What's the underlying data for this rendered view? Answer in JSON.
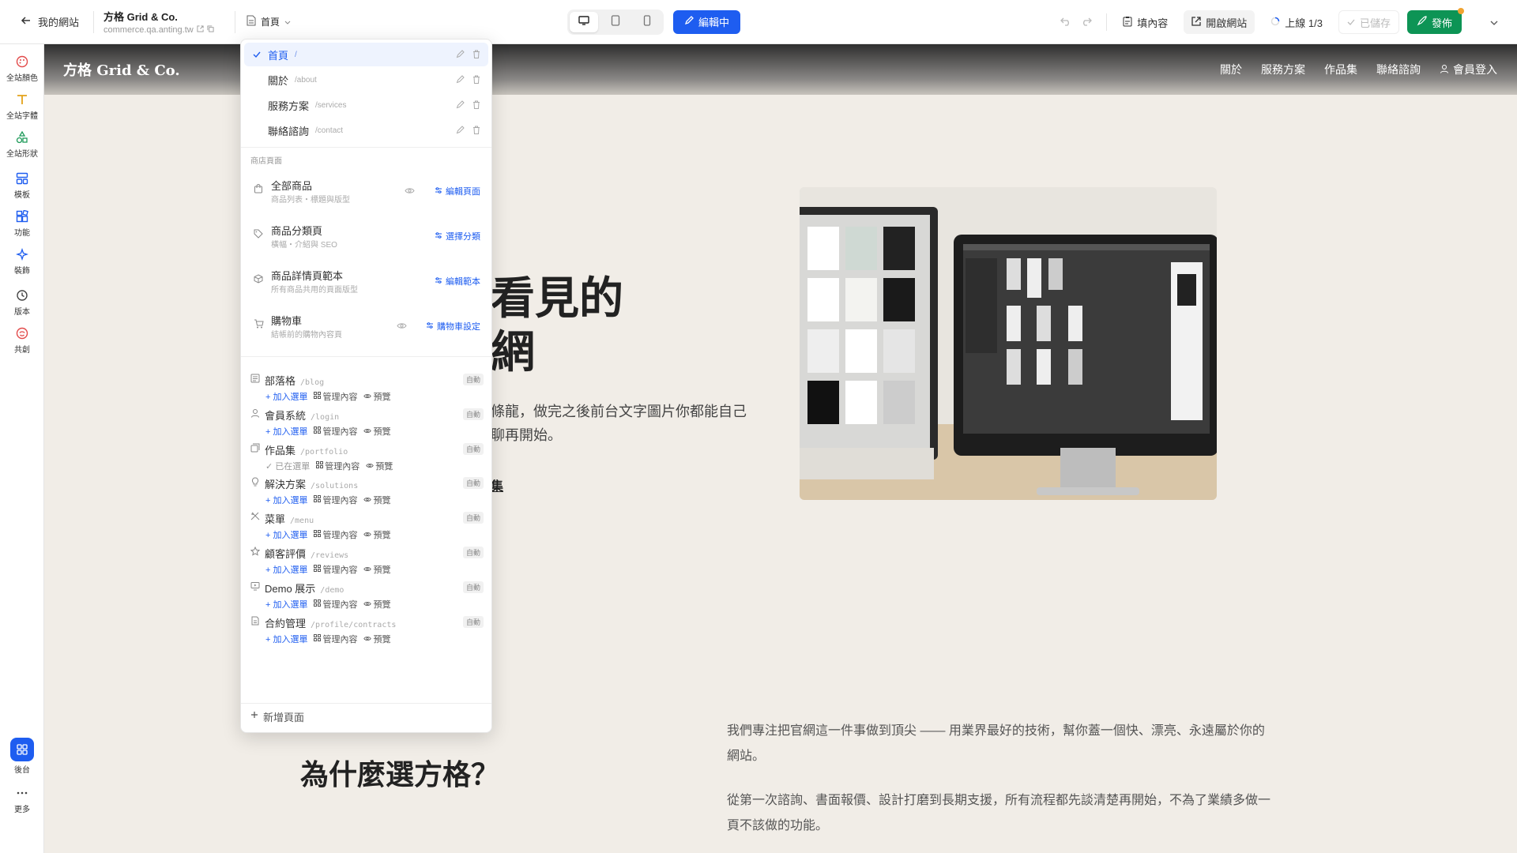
{
  "topbar": {
    "back_label": "我的網站",
    "site_name": "方格 Grid & Co.",
    "site_url": "commerce.qa.anting.tw",
    "current_page": "首頁",
    "edit_label": "編輯中",
    "fill_content": "填內容",
    "open_site": "開啟網站",
    "online": "上線 1/3",
    "saved": "已儲存",
    "publish": "發佈"
  },
  "sidebar": {
    "items": [
      {
        "label": "全站顏色",
        "icon": "palette-icon"
      },
      {
        "label": "全站字體",
        "icon": "text-icon"
      },
      {
        "label": "全站形狀",
        "icon": "shapes-icon"
      },
      {
        "label": "模板",
        "icon": "template-icon"
      },
      {
        "label": "功能",
        "icon": "blocks-icon"
      },
      {
        "label": "裝飾",
        "icon": "sparkle-icon"
      },
      {
        "label": "版本",
        "icon": "history-icon"
      },
      {
        "label": "共創",
        "icon": "cocreate-icon"
      }
    ],
    "admin_label": "後台",
    "more_label": "更多"
  },
  "site": {
    "logo": "方格 Grid & Co.",
    "nav": [
      "關於",
      "服務方案",
      "作品集",
      "聯絡諮詢"
    ],
    "login": "會員登入",
    "hero_line1": "看見的",
    "hero_line2": "網",
    "hero_desc": "條龍，做完之後前台文字圖片你都能自己\n聊再開始。",
    "hero_link": "集",
    "why_title": "為什麼選方格？",
    "why_p1": "我們專注把官網這一件事做到頂尖 —— 用業界最好的技術，幫你蓋一個快、漂亮、永遠屬於你的網站。",
    "why_p2": "從第一次諮詢、書面報價、設計打磨到長期支援，所有流程都先談清楚再開始，不為了業績多做一頁不該做的功能。"
  },
  "pagemenu": {
    "pages": [
      {
        "label": "首頁",
        "slug": "/"
      },
      {
        "label": "關於",
        "slug": "/about"
      },
      {
        "label": "服務方案",
        "slug": "/services"
      },
      {
        "label": "聯絡諮詢",
        "slug": "/contact"
      }
    ],
    "shop_section": "商店頁面",
    "shop_items": [
      {
        "title": "全部商品",
        "sub": "商品列表・標題與版型",
        "action": "編輯頁面"
      },
      {
        "title": "商品分類頁",
        "sub": "橫幅・介紹與 SEO",
        "action": "選擇分類"
      },
      {
        "title": "商品詳情頁範本",
        "sub": "所有商品共用的頁面版型",
        "action": "編輯範本"
      },
      {
        "title": "購物車",
        "sub": "結帳前的購物內容頁",
        "action": "購物車設定"
      }
    ],
    "auto_label": "自動",
    "add_to_menu": "+ 加入選單",
    "in_menu": "✓ 已在選單",
    "manage": "管理內容",
    "preview": "預覽",
    "features": [
      {
        "title": "部落格",
        "slug": "/blog",
        "in_menu": false
      },
      {
        "title": "會員系統",
        "slug": "/login",
        "in_menu": false
      },
      {
        "title": "作品集",
        "slug": "/portfolio",
        "in_menu": true
      },
      {
        "title": "解決方案",
        "slug": "/solutions",
        "in_menu": false
      },
      {
        "title": "菜單",
        "slug": "/menu",
        "in_menu": false
      },
      {
        "title": "顧客評價",
        "slug": "/reviews",
        "in_menu": false
      },
      {
        "title": "Demo 展示",
        "slug": "/demo",
        "in_menu": false
      },
      {
        "title": "合約管理",
        "slug": "/profile/contracts",
        "in_menu": false
      }
    ],
    "add_page": "新增頁面"
  },
  "colors": {
    "accent": "#1e5df0",
    "publish": "#0d9455",
    "canvas": "#f1ede7"
  }
}
